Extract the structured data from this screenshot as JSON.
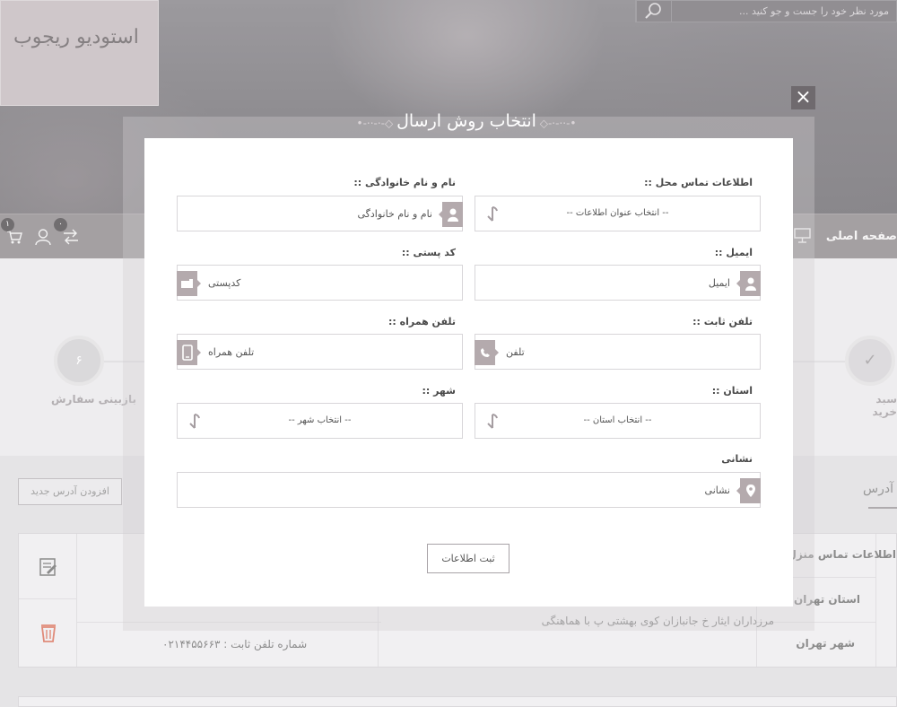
{
  "header": {
    "logo_text": "استودیو ریجوب",
    "search_placeholder": "مورد نظر خود را جست و جو کنید ..."
  },
  "nav": {
    "home_label": "صفحه اصلی",
    "cart_count": "۱",
    "compare_count": "۰"
  },
  "steps": [
    {
      "label": "سبد خرید",
      "mark": "✓"
    },
    {
      "label": "بازبینی سفارش",
      "mark": "۶"
    }
  ],
  "address_section": {
    "title": "آدرس",
    "new_address_button": "افزودن آدرس جدید",
    "row_labels": [
      "اطلاعات تماس منزل",
      "استان تهران",
      "شهر تهران"
    ],
    "address_text": "مرزداران ایثار خ جانبازان کوی بهشتی پ با هماهنگی",
    "phone_text": "شماره تلفن ثابت : ۰۲۱۴۴۵۵۶۶۳"
  },
  "modal": {
    "title": "انتخاب روش ارسال",
    "close": "×",
    "fields": {
      "contact_info": {
        "label": "اطلاعات تماس محل ::",
        "selected": "-- انتخاب عنوان اطلاعات --"
      },
      "full_name": {
        "label": "نام و نام خانوادگی ::",
        "placeholder": "نام و نام خانوادگی"
      },
      "email": {
        "label": "ایمیل ::",
        "placeholder": "ایمیل"
      },
      "postal_code": {
        "label": "کد پستی ::",
        "placeholder": "کدپستی"
      },
      "phone": {
        "label": "تلفن ثابت ::",
        "placeholder": "تلفن"
      },
      "mobile": {
        "label": "تلفن همراه ::",
        "placeholder": "تلفن همراه"
      },
      "province": {
        "label": "استان ::",
        "selected": "-- انتخاب استان --"
      },
      "city": {
        "label": "شهر ::",
        "selected": "-- انتخاب شهر --"
      },
      "address": {
        "label": "نشانی",
        "placeholder": "نشانی"
      }
    },
    "submit_label": "ثبت اطلاعات"
  },
  "colors": {
    "accent": "#b4aaad",
    "nav_bar": "#7a7377",
    "close_bg": "#6f6a6e"
  }
}
